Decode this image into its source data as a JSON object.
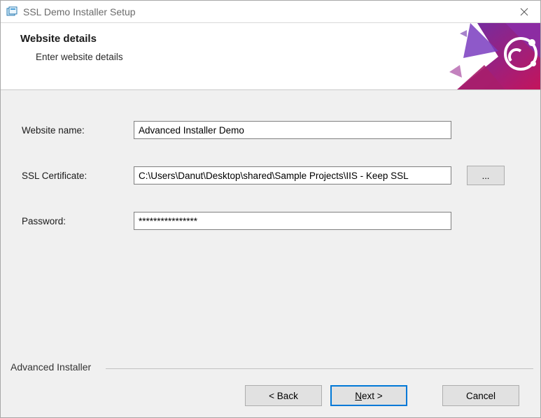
{
  "window": {
    "title": "SSL Demo Installer Setup"
  },
  "header": {
    "title": "Website details",
    "subtitle": "Enter website details"
  },
  "fields": {
    "website_name": {
      "label": "Website name:",
      "value": "Advanced Installer Demo"
    },
    "ssl_cert": {
      "label": "SSL Certificate:",
      "value": "C:\\Users\\Danut\\Desktop\\shared\\Sample Projects\\IIS - Keep SSL",
      "browse": "..."
    },
    "password": {
      "label": "Password:",
      "value": "****************"
    }
  },
  "footer": {
    "brand": "Advanced Installer",
    "back": "< Back",
    "next_prefix": "",
    "next_ul": "N",
    "next_suffix": "ext >",
    "cancel": "Cancel"
  }
}
